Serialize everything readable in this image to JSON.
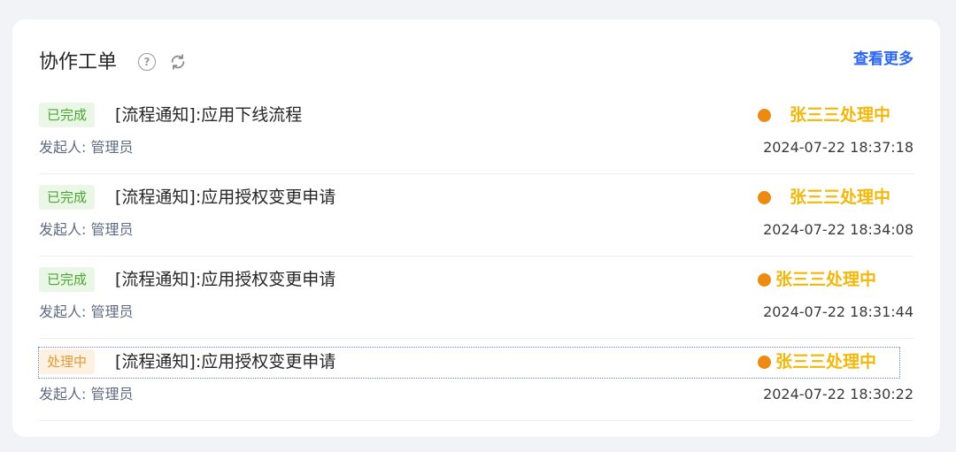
{
  "header": {
    "title": "协作工单",
    "help_icon": "question-circle-icon",
    "refresh_icon": "refresh-icon",
    "more_label": "查看更多"
  },
  "colors": {
    "done_badge_bg": "#eaf7e6",
    "done_badge_text": "#4aa533",
    "processing_badge_bg": "#fdf1e2",
    "processing_badge_text": "#e39a37",
    "status_dot": "#ec8a12",
    "status_text": "#f3b70a",
    "link": "#2b67f2"
  },
  "rows": [
    {
      "badge": "已完成",
      "badge_type": "done",
      "title": "[流程通知]:应用下线流程",
      "status": "张三三处理中",
      "initiator": "发起人: 管理员",
      "time": "2024-07-22 18:37:18"
    },
    {
      "badge": "已完成",
      "badge_type": "done",
      "title": "[流程通知]:应用授权变更申请",
      "status": "张三三处理中",
      "initiator": "发起人: 管理员",
      "time": "2024-07-22 18:34:08"
    },
    {
      "badge": "已完成",
      "badge_type": "done",
      "title": "[流程通知]:应用授权变更申请",
      "status": "张三三处理中",
      "initiator": "发起人: 管理员",
      "time": "2024-07-22 18:31:44"
    },
    {
      "badge": "处理中",
      "badge_type": "processing",
      "title": "[流程通知]:应用授权变更申请",
      "status": "张三三处理中",
      "initiator": "发起人: 管理员",
      "time": "2024-07-22 18:30:22"
    }
  ]
}
